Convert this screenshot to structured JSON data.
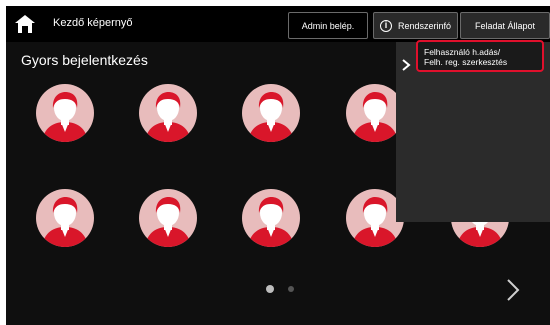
{
  "topbar": {
    "home_title": "Kezdő képernyő",
    "admin_label": "Admin belép.",
    "sysinfo_label": "Rendszerinfó",
    "status_label": "Feladat Állapot"
  },
  "main": {
    "section_title": "Gyors bejelentkezés"
  },
  "menu": {
    "item_line1": "Felhasználó h.adás/",
    "item_line2": "Felh. reg. szerkesztés"
  },
  "pagination": {
    "current": 1,
    "total": 2
  },
  "colors": {
    "background": "#0f0f0f",
    "avatar_circle": "#e8bcbc",
    "avatar_red": "#d9162a",
    "highlight": "#e0102c"
  },
  "icons": [
    "home-icon",
    "info-icon",
    "avatar-icon",
    "chevron-right-icon"
  ]
}
